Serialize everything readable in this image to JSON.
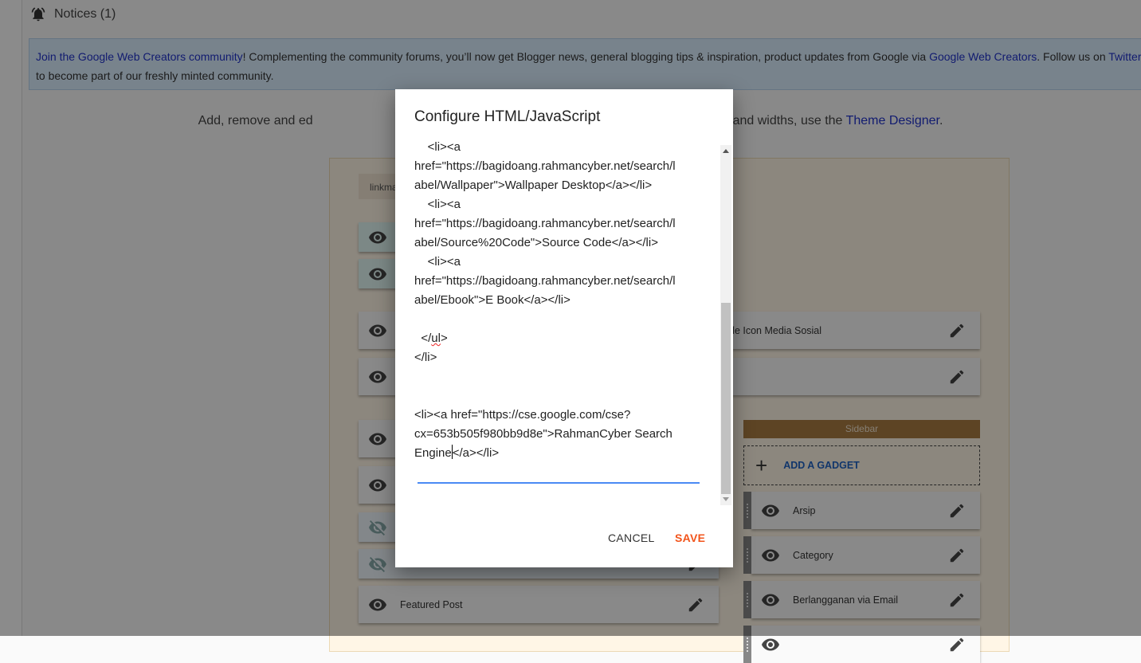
{
  "notices": {
    "label": "Notices (1)",
    "icon": "bell-icon"
  },
  "info": {
    "link1": "Join the Google Web Creators community",
    "text1": "! Complementing the community forums, you’ll now get Blogger news, general blogging tips & inspiration, product updates from Google via ",
    "link2": "Google Web Creators",
    "text2": ". Follow us on ",
    "link3": "Twitter",
    "text3": ",",
    "line2": "to become part of our freshly minted community."
  },
  "instructions": {
    "text_a": "Add, remove and ed",
    "text_b": "s. To change columns and widths, use the ",
    "link": "Theme Designer",
    "end": "."
  },
  "layout": {
    "section_label": "linkma",
    "left_rows": [
      {
        "label": "",
        "state": "visible",
        "style": "teal"
      },
      {
        "label": "",
        "state": "visible",
        "style": "teal"
      },
      {
        "label": "de Icon Media Sosial",
        "state": "visible",
        "style": "wide"
      },
      {
        "label": "",
        "state": "visible",
        "style": "wide"
      },
      {
        "label": "",
        "state": "visible",
        "style": "normal"
      },
      {
        "label": "",
        "state": "visible",
        "style": "normal"
      },
      {
        "label": "",
        "state": "hidden",
        "style": "hid"
      },
      {
        "label": "",
        "state": "hidden",
        "style": "hid"
      },
      {
        "label": "Featured Post",
        "state": "visible",
        "style": "normal"
      }
    ],
    "sidebar": {
      "title": "Sidebar",
      "add_gadget": "ADD A GADGET",
      "gadgets": [
        "Arsip",
        "Category",
        "Berlangganan via Email",
        ""
      ]
    }
  },
  "dialog": {
    "title": "Configure HTML/JavaScript",
    "code_lines": [
      "    <li><a",
      "href=\"https://bagidoang.rahmancyber.net/search/l",
      "abel/Wallpaper\">Wallpaper Desktop</a></li>",
      "    <li><a",
      "href=\"https://bagidoang.rahmancyber.net/search/l",
      "abel/Source%20Code\">Source Code</a></li>",
      "    <li><a",
      "href=\"https://bagidoang.rahmancyber.net/search/l",
      "abel/Ebook\">E Book</a></li>",
      "",
      "  </ul>",
      "</li>",
      "",
      "",
      "<li><a href=\"https://cse.google.com/cse?",
      "cx=653b505f980bb9d8e\">RahmanCyber Search",
      "Engine</a></li>"
    ],
    "cancel_label": "CANCEL",
    "save_label": "SAVE",
    "colors": {
      "save": "#f2541b",
      "focus_underline": "#4a8af4",
      "link": "#2233cc",
      "sidebar_header": "#a97c42"
    }
  }
}
